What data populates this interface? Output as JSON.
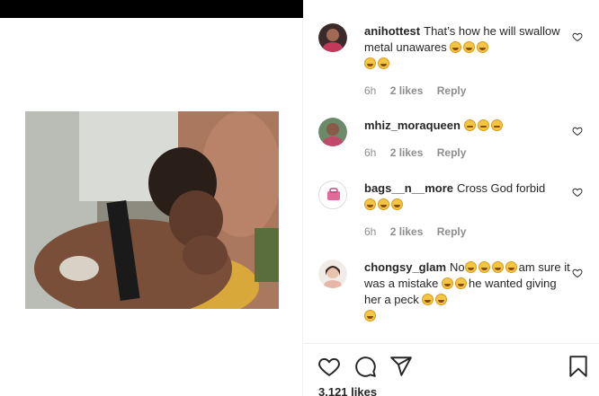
{
  "comments": [
    {
      "username": "anihottest",
      "text": "That’s how he will swallow metal unawares",
      "emoji_count_inline": 3,
      "emoji_count_wrap": 2,
      "time": "6h",
      "likes": "2 likes",
      "reply": "Reply"
    },
    {
      "username": "mhiz_moraqueen",
      "text": "",
      "emoji_count_inline": 3,
      "time": "6h",
      "likes": "2 likes",
      "reply": "Reply"
    },
    {
      "username": "bags__n__more",
      "text": "Cross God forbid",
      "emoji_count_wrap": 3,
      "time": "6h",
      "likes": "2 likes",
      "reply": "Reply"
    },
    {
      "username": "chongsy_glam",
      "text_a": "No",
      "text_b": "am sure it was a mistake",
      "text_c": "he wanted giving her a peck",
      "time": "",
      "likes": "",
      "reply": ""
    }
  ],
  "post": {
    "likes_count": "3.121 likes"
  },
  "colors": {
    "text": "#262626",
    "muted": "#8e8e8e",
    "divider": "#efefef"
  },
  "icons": [
    "heart-icon",
    "comment-icon",
    "share-icon",
    "bookmark-icon",
    "emoji-icon"
  ]
}
